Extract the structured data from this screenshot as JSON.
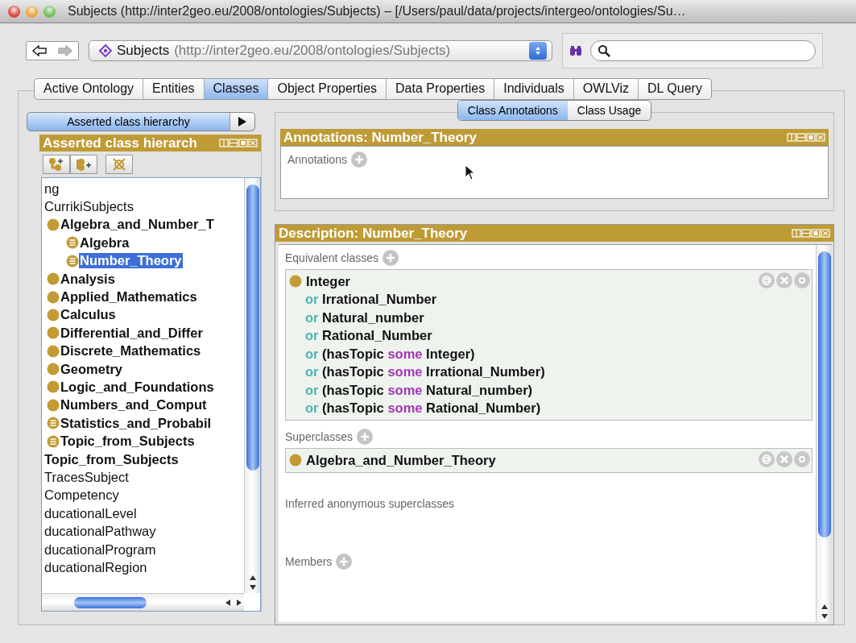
{
  "window": {
    "title": "Subjects (http://inter2geo.eu/2008/ontologies/Subjects) – [/Users/paul/data/projects/intergeo/ontologies/Su…"
  },
  "toolbar": {
    "back_disabled": false,
    "forward_disabled": true,
    "ontology_name": "Subjects",
    "ontology_iri": "(http://inter2geo.eu/2008/ontologies/Subjects)"
  },
  "tabs": [
    {
      "label": "Active Ontology",
      "selected": false
    },
    {
      "label": "Entities",
      "selected": false
    },
    {
      "label": "Classes",
      "selected": true
    },
    {
      "label": "Object Properties",
      "selected": false
    },
    {
      "label": "Data Properties",
      "selected": false
    },
    {
      "label": "Individuals",
      "selected": false
    },
    {
      "label": "OWLViz",
      "selected": false
    },
    {
      "label": "DL Query",
      "selected": false
    }
  ],
  "hierarchy_view": {
    "selector": "Asserted class hierarchy",
    "header": "Asserted class hierarch",
    "tree": [
      {
        "label": "ng",
        "kind": "plain",
        "bold": false,
        "selected": false
      },
      {
        "label": "CurrikiSubjects",
        "kind": "plain",
        "bold": false,
        "selected": false,
        "children": [
          {
            "label": "Algebra_and_Number_T",
            "kind": "class",
            "bold": true,
            "selected": false,
            "children": [
              {
                "label": "Algebra",
                "kind": "defined",
                "bold": true,
                "selected": false
              },
              {
                "label": "Number_Theory",
                "kind": "defined",
                "bold": true,
                "selected": true
              }
            ]
          },
          {
            "label": "Analysis",
            "kind": "class",
            "bold": true,
            "selected": false
          },
          {
            "label": "Applied_Mathematics",
            "kind": "class",
            "bold": true,
            "selected": false
          },
          {
            "label": "Calculus",
            "kind": "class",
            "bold": true,
            "selected": false
          },
          {
            "label": "Differential_and_Differ",
            "kind": "class",
            "bold": true,
            "selected": false
          },
          {
            "label": "Discrete_Mathematics",
            "kind": "class",
            "bold": true,
            "selected": false
          },
          {
            "label": "Geometry",
            "kind": "class",
            "bold": true,
            "selected": false
          },
          {
            "label": "Logic_and_Foundations",
            "kind": "class",
            "bold": true,
            "selected": false
          },
          {
            "label": "Numbers_and_Comput",
            "kind": "class",
            "bold": true,
            "selected": false
          },
          {
            "label": "Statistics_and_Probabil",
            "kind": "defined",
            "bold": true,
            "selected": false
          },
          {
            "label": "Topic_from_Subjects",
            "kind": "defined",
            "bold": true,
            "selected": false
          }
        ]
      },
      {
        "label": "Topic_from_Subjects",
        "kind": "plain",
        "bold": true,
        "selected": false
      },
      {
        "label": "TracesSubject",
        "kind": "plain",
        "bold": false,
        "selected": false
      },
      {
        "label": "Competency",
        "kind": "plain",
        "bold": false,
        "selected": false
      },
      {
        "label": "ducationalLevel",
        "kind": "plain",
        "bold": false,
        "selected": false
      },
      {
        "label": "ducationalPathway",
        "kind": "plain",
        "bold": false,
        "selected": false
      },
      {
        "label": "ducationalProgram",
        "kind": "plain",
        "bold": false,
        "selected": false
      },
      {
        "label": "ducationalRegion",
        "kind": "plain",
        "bold": false,
        "selected": false
      }
    ]
  },
  "class_view": {
    "subtabs": [
      {
        "label": "Class Annotations",
        "selected": true
      },
      {
        "label": "Class Usage",
        "selected": false
      }
    ],
    "annotations": {
      "header": "Annotations: Number_Theory",
      "label": "Annotations"
    },
    "description": {
      "header": "Description: Number_Theory",
      "sections": [
        {
          "label": "Equivalent classes",
          "addable": true,
          "entries": [
            {
              "lines": [
                [
                  {
                    "kind": "name",
                    "text": "Integer"
                  }
                ],
                [
                  {
                    "kind": "keyword",
                    "text": "or"
                  },
                  {
                    "kind": "name",
                    "text": "Irrational_Number"
                  }
                ],
                [
                  {
                    "kind": "keyword",
                    "text": "or"
                  },
                  {
                    "kind": "name",
                    "text": "Natural_number"
                  }
                ],
                [
                  {
                    "kind": "keyword",
                    "text": "or"
                  },
                  {
                    "kind": "name",
                    "text": "Rational_Number"
                  }
                ],
                [
                  {
                    "kind": "keyword",
                    "text": "or"
                  },
                  {
                    "kind": "name",
                    "text": "(hasTopic"
                  },
                  {
                    "kind": "quantifier",
                    "text": "some"
                  },
                  {
                    "kind": "name",
                    "text": "Integer)"
                  }
                ],
                [
                  {
                    "kind": "keyword",
                    "text": "or"
                  },
                  {
                    "kind": "name",
                    "text": "(hasTopic"
                  },
                  {
                    "kind": "quantifier",
                    "text": "some"
                  },
                  {
                    "kind": "name",
                    "text": "Irrational_Number)"
                  }
                ],
                [
                  {
                    "kind": "keyword",
                    "text": "or"
                  },
                  {
                    "kind": "name",
                    "text": "(hasTopic"
                  },
                  {
                    "kind": "quantifier",
                    "text": "some"
                  },
                  {
                    "kind": "name",
                    "text": "Natural_number)"
                  }
                ],
                [
                  {
                    "kind": "keyword",
                    "text": "or"
                  },
                  {
                    "kind": "name",
                    "text": "(hasTopic"
                  },
                  {
                    "kind": "quantifier",
                    "text": "some"
                  },
                  {
                    "kind": "name",
                    "text": "Rational_Number)"
                  }
                ]
              ]
            }
          ]
        },
        {
          "label": "Superclasses",
          "addable": true,
          "entries": [
            {
              "lines": [
                [
                  {
                    "kind": "name",
                    "text": "Algebra_and_Number_Theory"
                  }
                ]
              ]
            }
          ]
        },
        {
          "label": "Inferred anonymous superclasses",
          "addable": false
        },
        {
          "label": "Members",
          "addable": true
        }
      ]
    }
  }
}
